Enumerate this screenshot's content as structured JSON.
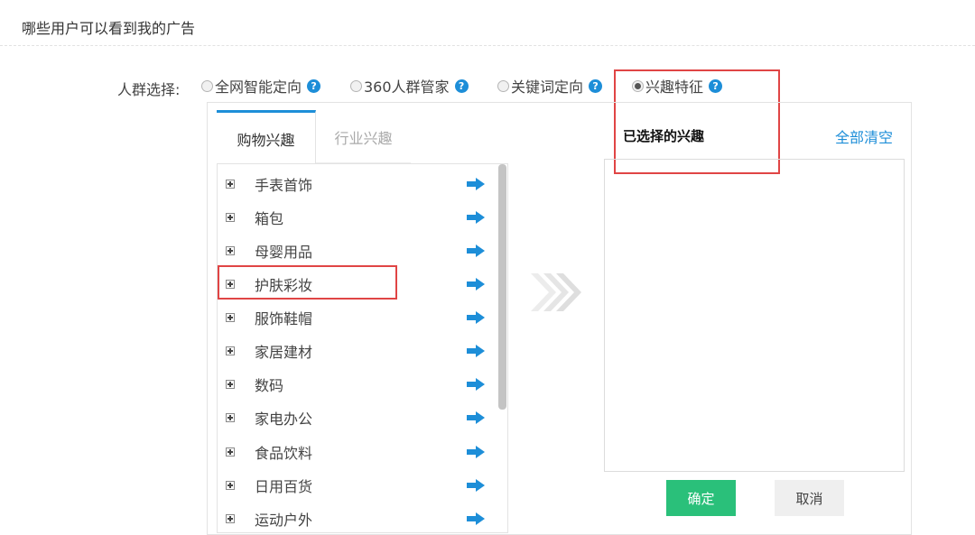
{
  "header": {
    "title": "哪些用户可以看到我的广告"
  },
  "targeting": {
    "label": "人群选择:",
    "options": [
      {
        "label": "全网智能定向",
        "checked": false
      },
      {
        "label": "360人群管家",
        "checked": false
      },
      {
        "label": "关键词定向",
        "checked": false
      },
      {
        "label": "兴趣特征",
        "checked": true
      }
    ],
    "help_icon": "question-circle-icon"
  },
  "tabs": [
    {
      "label": "购物兴趣",
      "active": true
    },
    {
      "label": "行业兴趣",
      "active": false
    }
  ],
  "interest_list": {
    "items": [
      "手表首饰",
      "箱包",
      "母婴用品",
      "护肤彩妆",
      "服饰鞋帽",
      "家居建材",
      "数码",
      "家电办公",
      "食品饮料",
      "日用百货",
      "运动户外"
    ],
    "highlighted_item": "护肤彩妆",
    "expand_icon": "plus-square-icon",
    "add_icon": "arrow-right-icon"
  },
  "selected_panel": {
    "title": "已选择的兴趣",
    "clear_all": "全部清空"
  },
  "buttons": {
    "confirm": "确定",
    "cancel": "取消"
  },
  "colors": {
    "accent_blue": "#1d8ed8",
    "confirm_green": "#2ac07a",
    "highlight_red": "#e04545"
  }
}
